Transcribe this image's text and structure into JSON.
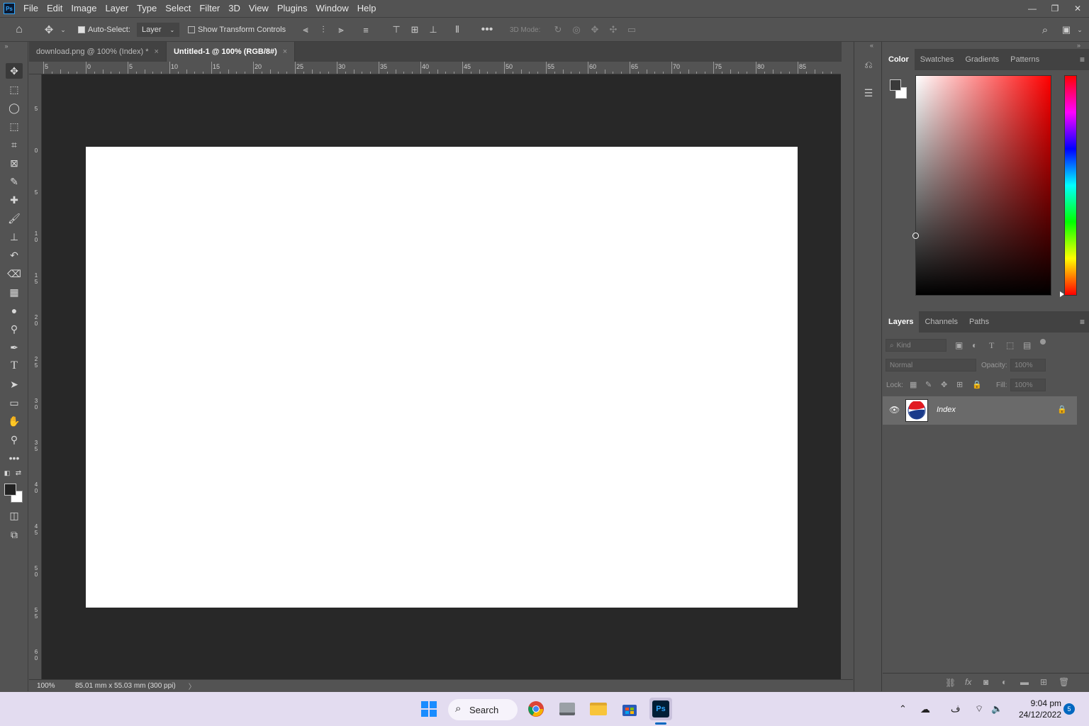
{
  "menubar": {
    "logo": "Ps",
    "items": [
      "File",
      "Edit",
      "Image",
      "Layer",
      "Type",
      "Select",
      "Filter",
      "3D",
      "View",
      "Plugins",
      "Window",
      "Help"
    ]
  },
  "options": {
    "auto_select_label": "Auto-Select:",
    "auto_select_value": "Layer",
    "show_transform_label": "Show Transform Controls",
    "mode_3d_label": "3D Mode:"
  },
  "documents": {
    "tabs": [
      {
        "label": "download.png @ 100% (Index) *",
        "active": false
      },
      {
        "label": "Untitled-1 @ 100% (RGB/8#)",
        "active": true
      }
    ],
    "close_glyph": "×"
  },
  "rulers": {
    "horizontal": [
      "5",
      "0",
      "5",
      "10",
      "15",
      "20",
      "25",
      "30",
      "35",
      "40",
      "45",
      "50",
      "55",
      "60",
      "65",
      "70",
      "75",
      "80",
      "85"
    ],
    "vertical": [
      "5",
      "0",
      "5",
      "1 0",
      "1 5",
      "2 0",
      "2 5",
      "3 0",
      "3 5",
      "4 0",
      "4 5",
      "5 0",
      "5 5",
      "6 0"
    ]
  },
  "status": {
    "zoom": "100%",
    "doc_info": "85.01 mm x 55.03 mm (300 ppi)",
    "arrow": "〉"
  },
  "color_panel": {
    "tabs": [
      "Color",
      "Swatches",
      "Gradients",
      "Patterns"
    ],
    "active_tab": "Color",
    "base_hue": "#ff0000"
  },
  "layers_panel": {
    "tabs": [
      "Layers",
      "Channels",
      "Paths"
    ],
    "active_tab": "Layers",
    "filter_placeholder": "Kind",
    "blend_mode": "Normal",
    "opacity_label": "Opacity:",
    "opacity_value": "100%",
    "lock_label": "Lock:",
    "fill_label": "Fill:",
    "fill_value": "100%",
    "layers": [
      {
        "name": "Index",
        "visible": true,
        "locked": true
      }
    ]
  },
  "taskbar": {
    "search_label": "Search",
    "lang_indicator": "ف",
    "time": "9:04 pm",
    "date": "24/12/2022",
    "notifications": "5"
  }
}
